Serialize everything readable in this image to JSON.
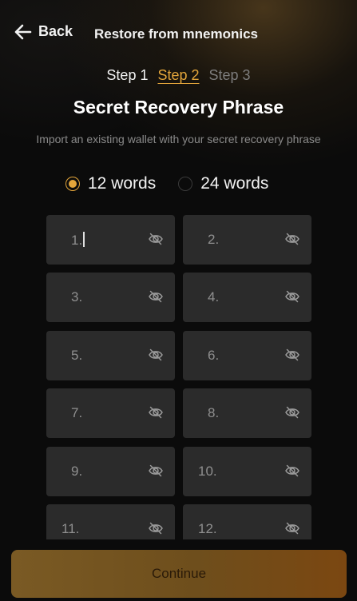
{
  "header": {
    "back_label": "Back",
    "back_icon": "arrow-left-icon",
    "title": "Restore from mnemonics"
  },
  "steps": [
    {
      "label": "Step 1",
      "state": "done"
    },
    {
      "label": "Step 2",
      "state": "active"
    },
    {
      "label": "Step 3",
      "state": "upcoming"
    }
  ],
  "main": {
    "title": "Secret Recovery Phrase",
    "subtitle": "Import an existing wallet with your secret recovery phrase"
  },
  "word_count": {
    "options": [
      {
        "label": "12 words",
        "selected": true
      },
      {
        "label": "24 words",
        "selected": false
      }
    ]
  },
  "words": [
    {
      "number": "1.",
      "value": "",
      "focused": true
    },
    {
      "number": "2.",
      "value": ""
    },
    {
      "number": "3.",
      "value": ""
    },
    {
      "number": "4.",
      "value": ""
    },
    {
      "number": "5.",
      "value": ""
    },
    {
      "number": "6.",
      "value": ""
    },
    {
      "number": "7.",
      "value": ""
    },
    {
      "number": "8.",
      "value": ""
    },
    {
      "number": "9.",
      "value": ""
    },
    {
      "number": "10.",
      "value": ""
    },
    {
      "number": "11.",
      "value": ""
    },
    {
      "number": "12.",
      "value": ""
    }
  ],
  "word_visibility_icon": "eye-slash-icon",
  "continue_label": "Continue",
  "colors": {
    "accent": "#e3a53b",
    "background": "#0b0b0b",
    "cell": "#2b2b2b",
    "muted_text": "#8a8a8a"
  }
}
